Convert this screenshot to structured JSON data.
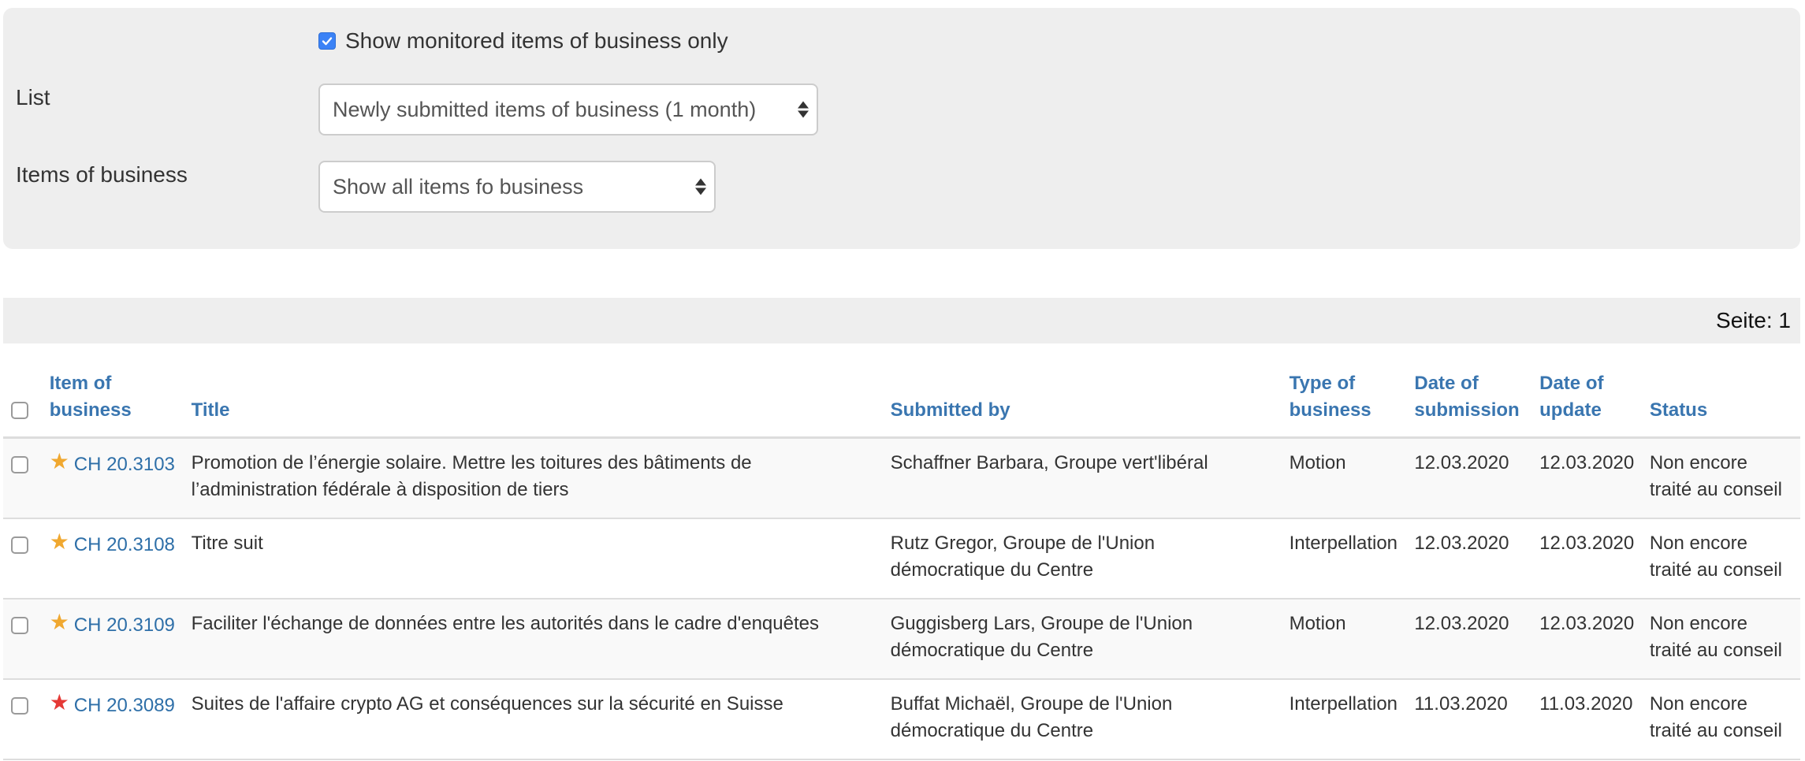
{
  "filters": {
    "monitored_only_label": "Show monitored items of business only",
    "monitored_only_checked": true,
    "list_label": "List",
    "list_value": "Newly submitted items of business (1 month)",
    "items_label": "Items of business",
    "items_value": "Show all items fo business"
  },
  "pagination": {
    "page_label": "Seite: 1"
  },
  "table": {
    "headers": {
      "item": "Item of business",
      "title": "Title",
      "submitted_by": "Submitted by",
      "type": "Type of business",
      "date_submission": "Date of submission",
      "date_update": "Date of update",
      "status": "Status"
    },
    "rows": [
      {
        "star": "★",
        "star_color": "#f0a830",
        "item": "CH 20.3103",
        "title": "Promotion de l’énergie solaire. Mettre les toitures des bâtiments de l’administration fédérale à disposition de tiers",
        "submitted_by": "Schaffner Barbara, Groupe vert'libéral",
        "type": "Motion",
        "date_submission": "12.03.2020",
        "date_update": "12.03.2020",
        "status": "Non encore traité au conseil"
      },
      {
        "star": "★",
        "star_color": "#f0a830",
        "item": "CH 20.3108",
        "title": "Titre suit",
        "submitted_by": "Rutz Gregor, Groupe de l'Union démocratique du Centre",
        "type": "Interpellation",
        "date_submission": "12.03.2020",
        "date_update": "12.03.2020",
        "status": "Non encore traité au conseil"
      },
      {
        "star": "★",
        "star_color": "#f0a830",
        "item": "CH 20.3109",
        "title": "Faciliter l'échange de données entre les autorités dans le cadre d'enquêtes",
        "submitted_by": "Guggisberg Lars, Groupe de l'Union démocratique du Centre",
        "type": "Motion",
        "date_submission": "12.03.2020",
        "date_update": "12.03.2020",
        "status": "Non encore traité au conseil"
      },
      {
        "star": "★",
        "star_color": "#e53935",
        "item": "CH 20.3089",
        "title": "Suites de l'affaire crypto AG et conséquences sur la sécurité en Suisse",
        "submitted_by": "Buffat Michaël, Groupe de l'Union démocratique du Centre",
        "type": "Interpellation",
        "date_submission": "11.03.2020",
        "date_update": "11.03.2020",
        "status": "Non encore traité au conseil"
      }
    ]
  }
}
